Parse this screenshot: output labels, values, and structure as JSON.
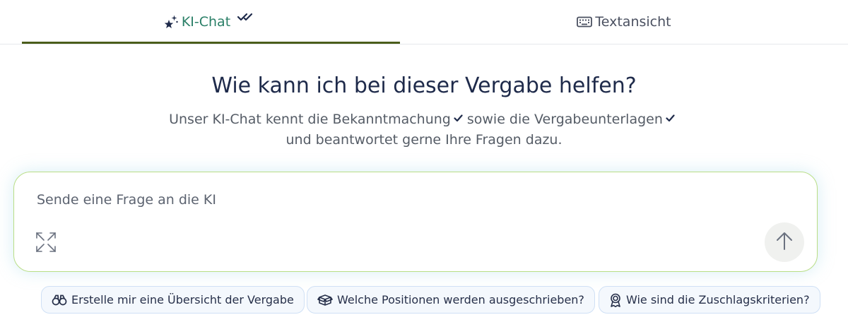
{
  "tabs": [
    {
      "label": "KI-Chat",
      "icon": "sparkle-star-icon",
      "active": true,
      "badge_icon": "double-check-icon"
    },
    {
      "label": "Textansicht",
      "icon": "keyboard-icon",
      "active": false
    }
  ],
  "main": {
    "heading": "Wie kann ich bei dieser Vergabe helfen?",
    "sub_part1": "Unser KI-Chat kennt die Bekanntmachung",
    "sub_part2": "sowie die Vergabeunterlagen",
    "sub_line2": "und beantwortet gerne Ihre Fragen dazu."
  },
  "chat": {
    "placeholder": "Sende eine Frage an die KI",
    "value": "",
    "expand_icon": "expand-icon",
    "send_icon": "arrow-up-icon"
  },
  "suggestions": [
    {
      "label": "Erstelle mir eine Übersicht der Vergabe",
      "icon": "binoculars-icon"
    },
    {
      "label": "Welche Positionen werden ausgeschrieben?",
      "icon": "box-icon"
    },
    {
      "label": "Wie sind die Zuschlagskriterien?",
      "icon": "award-icon"
    }
  ],
  "colors": {
    "accent_green": "#2a7f67",
    "tab_underline": "#4b5e1b",
    "chat_border": "#b9de86",
    "chip_border": "#cfe0f5"
  }
}
